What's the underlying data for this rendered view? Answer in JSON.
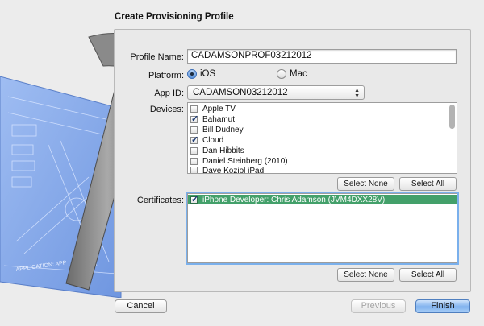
{
  "dialog": {
    "title": "Create Provisioning Profile"
  },
  "form": {
    "profile_name_label": "Profile Name:",
    "profile_name_value": "CADAMSONPROF03212012",
    "platform_label": "Platform:",
    "platform_ios": "iOS",
    "platform_mac": "Mac",
    "platform_selected": "iOS",
    "app_id_label": "App ID:",
    "app_id_value": "CADAMSON03212012",
    "devices_label": "Devices:",
    "certificates_label": "Certificates:"
  },
  "devices": [
    {
      "name": "Apple TV",
      "checked": false
    },
    {
      "name": "Bahamut",
      "checked": true
    },
    {
      "name": "Bill Dudney",
      "checked": false
    },
    {
      "name": "Cloud",
      "checked": true
    },
    {
      "name": "Dan Hibbits",
      "checked": false
    },
    {
      "name": "Daniel Steinberg (2010)",
      "checked": false
    },
    {
      "name": "Dave Koziol iPad",
      "checked": false
    }
  ],
  "certificates": [
    {
      "name": "iPhone Developer: Chris Adamson (JVM4DXX28V)",
      "checked": true
    }
  ],
  "buttons": {
    "select_none": "Select None",
    "select_all": "Select All",
    "cancel": "Cancel",
    "previous": "Previous",
    "finish": "Finish"
  },
  "illustration": {
    "blueprint_caption": "APPLICATION: APP"
  },
  "colors": {
    "selection_green": "#43a06a",
    "focus_ring": "#7ab0ec",
    "primary_button": "#7fb1ee",
    "blueprint_blue": "#7fa3e8"
  }
}
